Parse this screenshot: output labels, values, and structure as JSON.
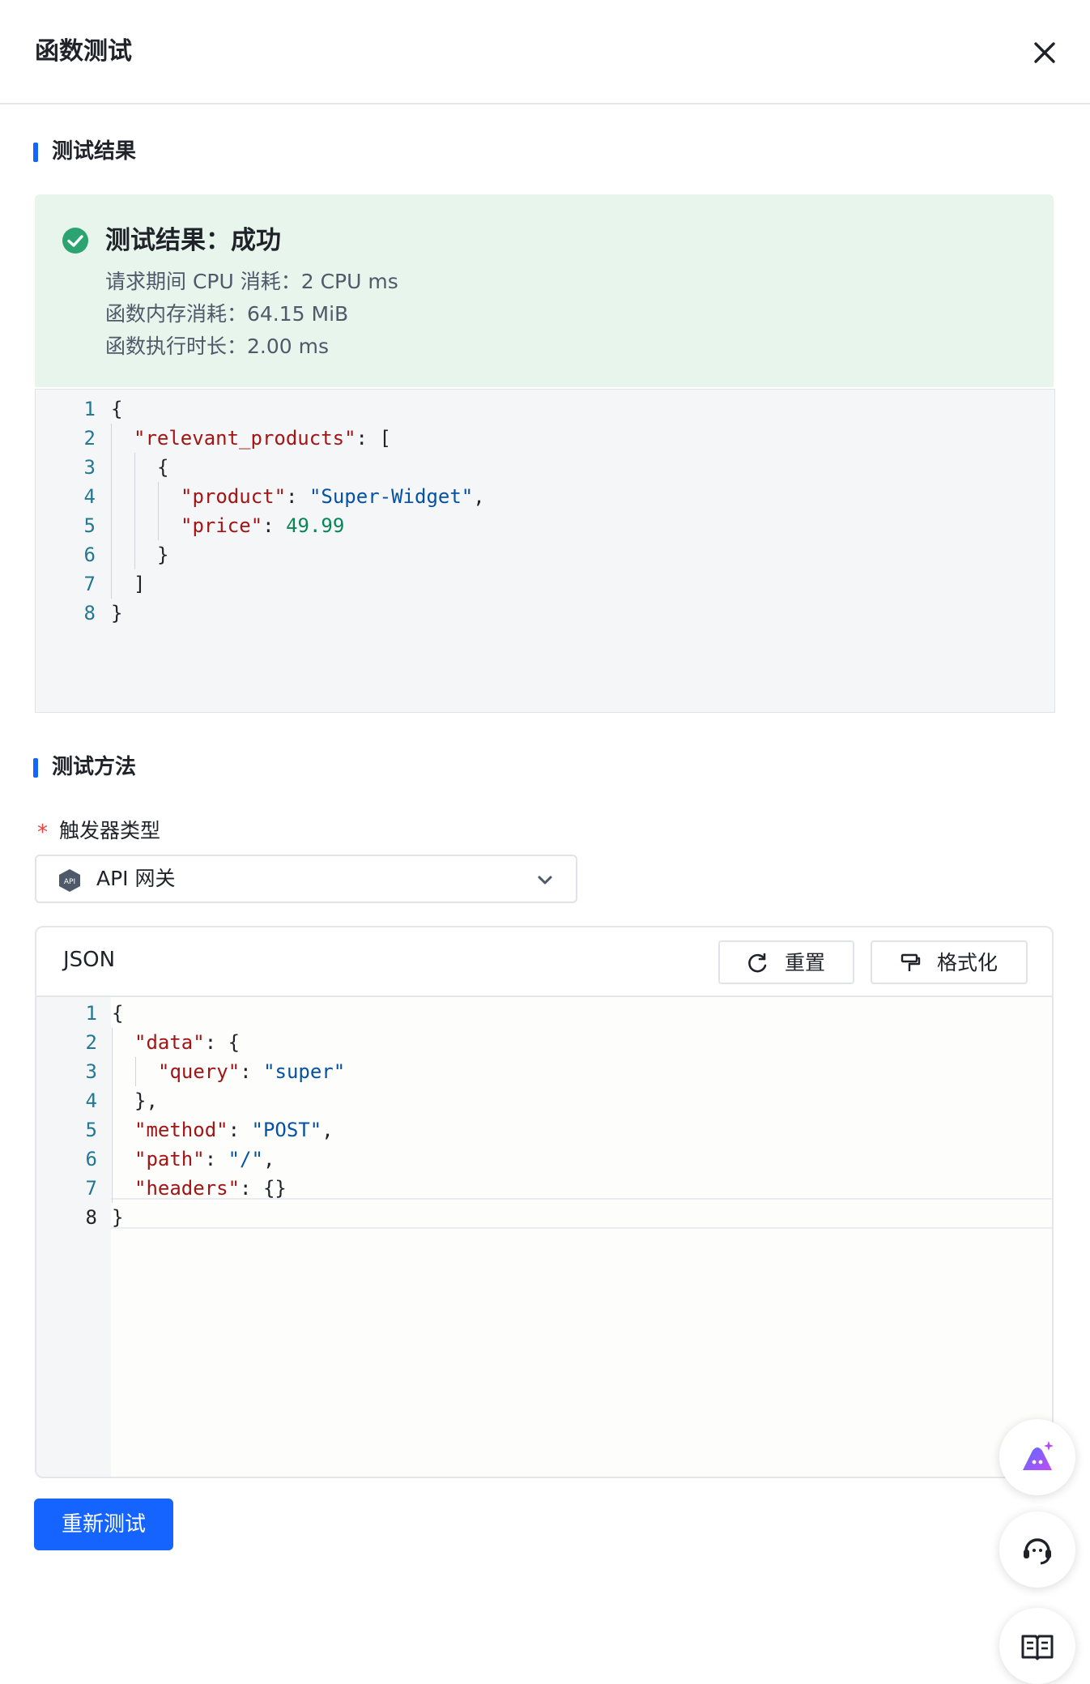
{
  "header": {
    "title": "函数测试"
  },
  "result_section": {
    "title": "测试结果",
    "status": "测试结果：成功",
    "lines": [
      "请求期间 CPU 消耗：2 CPU ms",
      "函数内存消耗：64.15 MiB",
      "函数执行时长：2.00 ms"
    ]
  },
  "result_code": {
    "line_numbers": [
      "1",
      "2",
      "3",
      "4",
      "5",
      "6",
      "7",
      "8"
    ],
    "key_relevant_products": "\"relevant_products\"",
    "key_product": "\"product\"",
    "val_product": "\"Super-Widget\"",
    "key_price": "\"price\"",
    "val_price": "49.99"
  },
  "method_section": {
    "title": "测试方法",
    "trigger_label": "触发器类型",
    "required_mark": "*",
    "trigger_value": "API 网关",
    "trigger_icon_text": "API"
  },
  "editor": {
    "label": "JSON",
    "reset_label": "重置",
    "format_label": "格式化",
    "line_numbers": [
      "1",
      "2",
      "3",
      "4",
      "5",
      "6",
      "7",
      "8"
    ],
    "key_data": "\"data\"",
    "key_query": "\"query\"",
    "val_query": "\"super\"",
    "key_method": "\"method\"",
    "val_method": "\"POST\"",
    "key_path": "\"path\"",
    "val_path": "\"/\"",
    "key_headers": "\"headers\""
  },
  "actions": {
    "retest_label": "重新测试"
  },
  "colors": {
    "accent": "#1664ff",
    "success": "#2ba471",
    "success_bg": "#e8f5ec",
    "required": "#f53f3f"
  },
  "icons": [
    "close-icon",
    "check-circle-icon",
    "api-gateway-icon",
    "chevron-down-icon",
    "refresh-icon",
    "format-painter-icon",
    "ai-assistant-icon",
    "support-icon",
    "docs-book-icon"
  ]
}
